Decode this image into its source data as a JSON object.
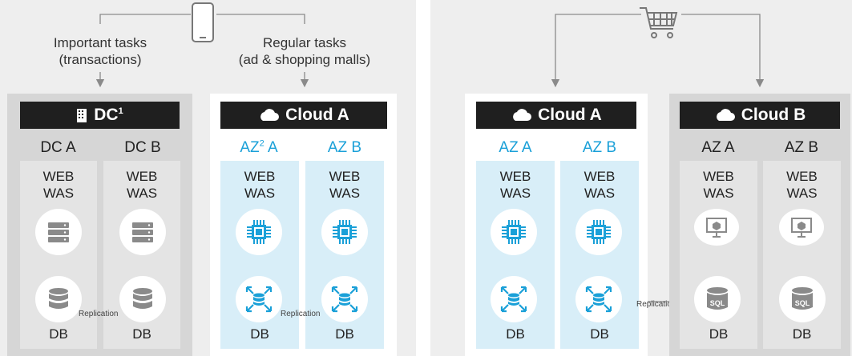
{
  "colors": {
    "panel_bg": "#eeeeee",
    "dc_inner": "#d6d6d6",
    "dc_col": "#e4e4e4",
    "cloud_inner": "#ffffff",
    "cloud_col": "#d8eef8",
    "accent": "#1aa0d8",
    "header_bg": "#1f1f1f",
    "line": "#8a8a8a"
  },
  "left": {
    "important_tasks": "Important tasks",
    "important_tasks_sub": "(transactions)",
    "regular_tasks": "Regular tasks",
    "regular_tasks_sub": "(ad & shopping malls)",
    "dc": {
      "title": "DC",
      "sup": "1",
      "cols": [
        "DC A",
        "DC B"
      ]
    },
    "cloud_a": {
      "title": "Cloud A",
      "cols": [
        "AZ",
        "A",
        "AZ B"
      ],
      "sup": "2"
    },
    "web": "WEB",
    "was": "WAS",
    "db": "DB",
    "replication": "Replication"
  },
  "right": {
    "cloud_a": {
      "title": "Cloud A",
      "cols": [
        "AZ A",
        "AZ B"
      ]
    },
    "cloud_b": {
      "title": "Cloud B",
      "cols": [
        "AZ A",
        "AZ B"
      ]
    },
    "web": "WEB",
    "was": "WAS",
    "db": "DB",
    "replication": "Replication",
    "sql": "SQL"
  },
  "icons": [
    "smartphone-icon",
    "shopping-cart-icon",
    "building-icon",
    "cloud-icon",
    "server-icon",
    "database-icon",
    "cpu-chip-icon",
    "scale-database-icon",
    "vm-monitor-icon",
    "sql-database-icon"
  ]
}
